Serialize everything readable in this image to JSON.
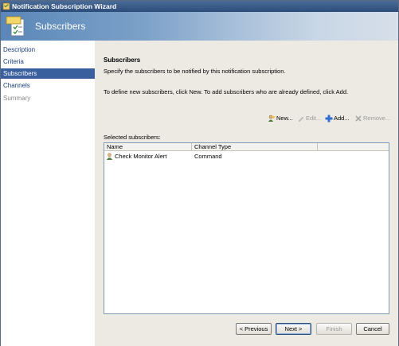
{
  "window": {
    "title": "Notification Subscription Wizard"
  },
  "header": {
    "title": "Subscribers",
    "icon": "wizard-checklist-icon"
  },
  "sidebar": {
    "items": [
      {
        "label": "Description",
        "state": "normal"
      },
      {
        "label": "Criteria",
        "state": "normal"
      },
      {
        "label": "Subscribers",
        "state": "active"
      },
      {
        "label": "Channels",
        "state": "normal"
      },
      {
        "label": "Summary",
        "state": "disabled"
      }
    ]
  },
  "main": {
    "section_title": "Subscribers",
    "description": "Specify the subscribers to be notified by this notification subscription.",
    "instructions": "To define new subscribers, click New.  To add subscribers who are already defined, click Add.",
    "toolbar": {
      "new_label": "New...",
      "edit_label": "Edit...",
      "add_label": "Add...",
      "remove_label": "Remove..."
    },
    "selected_label": "Selected subscribers:",
    "table": {
      "columns": [
        "Name",
        "Channel Type"
      ],
      "rows": [
        {
          "name": "Check Monitor Alert",
          "channel_type": "Command"
        }
      ]
    }
  },
  "footer": {
    "previous_label": "< Previous",
    "next_label": "Next >",
    "finish_label": "Finish",
    "cancel_label": "Cancel"
  },
  "colors": {
    "nav_active_bg": "#3a5f9e",
    "nav_link": "#1a3e7a",
    "titlebar": "#2c4d7a"
  }
}
